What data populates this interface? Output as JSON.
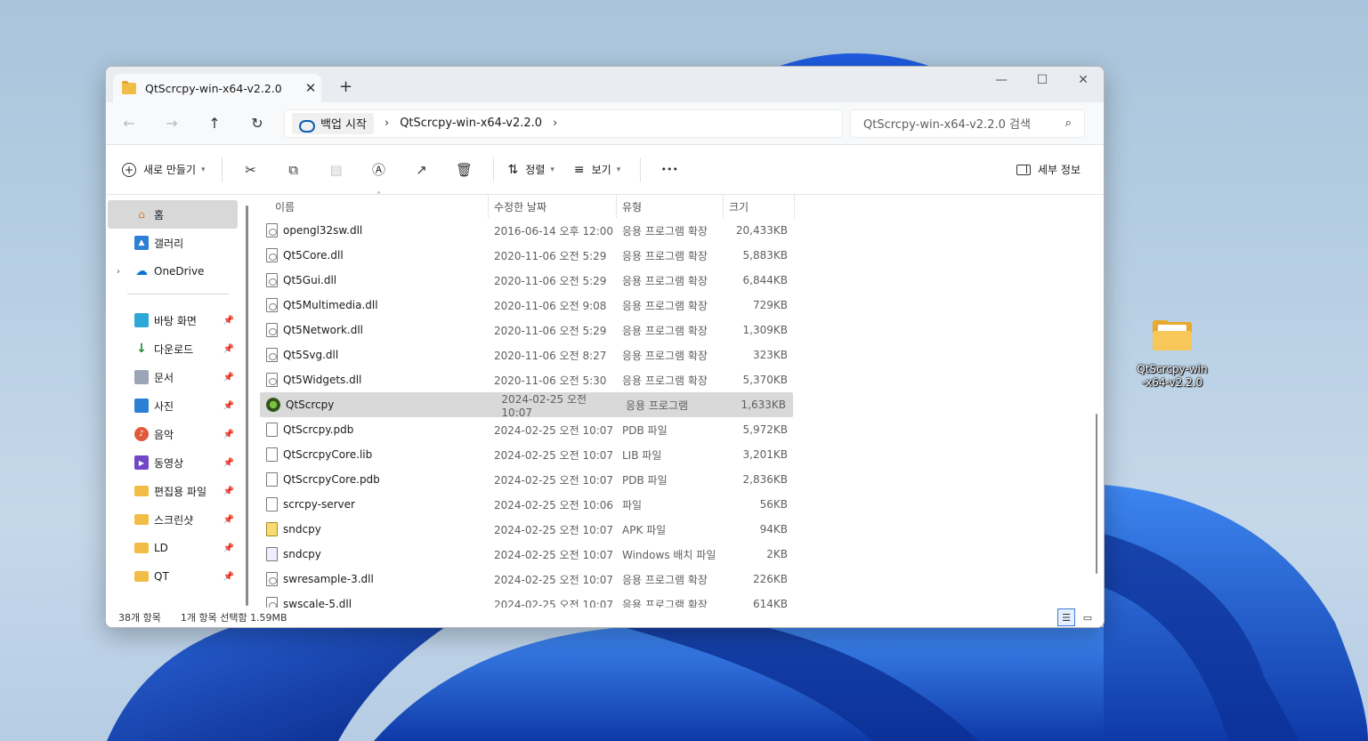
{
  "window": {
    "tab_title": "QtScrcpy-win-x64-v2.2.0",
    "tab_close": "✕",
    "new_tab": "+",
    "minimize": "—",
    "maximize": "☐",
    "close": "✕"
  },
  "navbar": {
    "back": "←",
    "forward": "→",
    "up": "↑",
    "refresh": "↻",
    "crumbs": [
      "백업 시작",
      "QtScrcpy-win-x64-v2.2.0"
    ],
    "search_placeholder": "QtScrcpy-win-x64-v2.2.0 검색"
  },
  "toolbar": {
    "new_label": "새로 만들기",
    "sort_label": "정렬",
    "view_label": "보기",
    "more": "•••",
    "details_label": "세부 정보",
    "icons": [
      "cut-icon",
      "copy-icon",
      "paste-icon",
      "rename-icon",
      "share-icon",
      "delete-icon"
    ]
  },
  "sidebar": {
    "top": [
      {
        "label": "홈",
        "icon": "home-icon"
      },
      {
        "label": "갤러리",
        "icon": "gallery-icon"
      },
      {
        "label": "OneDrive",
        "icon": "onedrive-icon"
      }
    ],
    "pinned": [
      {
        "label": "바탕 화면",
        "icon": "desktop-icon"
      },
      {
        "label": "다운로드",
        "icon": "download-icon"
      },
      {
        "label": "문서",
        "icon": "documents-icon"
      },
      {
        "label": "사진",
        "icon": "pictures-icon"
      },
      {
        "label": "음악",
        "icon": "music-icon"
      },
      {
        "label": "동영상",
        "icon": "videos-icon"
      },
      {
        "label": "편집용 파일",
        "icon": "folder-icon"
      },
      {
        "label": "스크린샷",
        "icon": "folder-icon"
      },
      {
        "label": "LD",
        "icon": "folder-icon"
      },
      {
        "label": "QT",
        "icon": "folder-icon"
      }
    ]
  },
  "columns": {
    "name": "이름",
    "date": "수정한 날짜",
    "type": "유형",
    "size": "크기"
  },
  "files": [
    {
      "name": "opengl32sw.dll",
      "date": "2016-06-14 오후 12:00",
      "type": "응용 프로그램 확장",
      "size": "20,433KB",
      "kind": "dll"
    },
    {
      "name": "Qt5Core.dll",
      "date": "2020-11-06 오전 5:29",
      "type": "응용 프로그램 확장",
      "size": "5,883KB",
      "kind": "dll"
    },
    {
      "name": "Qt5Gui.dll",
      "date": "2020-11-06 오전 5:29",
      "type": "응용 프로그램 확장",
      "size": "6,844KB",
      "kind": "dll"
    },
    {
      "name": "Qt5Multimedia.dll",
      "date": "2020-11-06 오전 9:08",
      "type": "응용 프로그램 확장",
      "size": "729KB",
      "kind": "dll"
    },
    {
      "name": "Qt5Network.dll",
      "date": "2020-11-06 오전 5:29",
      "type": "응용 프로그램 확장",
      "size": "1,309KB",
      "kind": "dll"
    },
    {
      "name": "Qt5Svg.dll",
      "date": "2020-11-06 오전 8:27",
      "type": "응용 프로그램 확장",
      "size": "323KB",
      "kind": "dll"
    },
    {
      "name": "Qt5Widgets.dll",
      "date": "2020-11-06 오전 5:30",
      "type": "응용 프로그램 확장",
      "size": "5,370KB",
      "kind": "dll"
    },
    {
      "name": "QtScrcpy",
      "date": "2024-02-25 오전 10:07",
      "type": "응용 프로그램",
      "size": "1,633KB",
      "kind": "app",
      "selected": true
    },
    {
      "name": "QtScrcpy.pdb",
      "date": "2024-02-25 오전 10:07",
      "type": "PDB 파일",
      "size": "5,972KB",
      "kind": "file"
    },
    {
      "name": "QtScrcpyCore.lib",
      "date": "2024-02-25 오전 10:07",
      "type": "LIB 파일",
      "size": "3,201KB",
      "kind": "file"
    },
    {
      "name": "QtScrcpyCore.pdb",
      "date": "2024-02-25 오전 10:07",
      "type": "PDB 파일",
      "size": "2,836KB",
      "kind": "file"
    },
    {
      "name": "scrcpy-server",
      "date": "2024-02-25 오전 10:06",
      "type": "파일",
      "size": "56KB",
      "kind": "file"
    },
    {
      "name": "sndcpy",
      "date": "2024-02-25 오전 10:07",
      "type": "APK 파일",
      "size": "94KB",
      "kind": "apk"
    },
    {
      "name": "sndcpy",
      "date": "2024-02-25 오전 10:07",
      "type": "Windows 배치 파일",
      "size": "2KB",
      "kind": "bat"
    },
    {
      "name": "swresample-3.dll",
      "date": "2024-02-25 오전 10:07",
      "type": "응용 프로그램 확장",
      "size": "226KB",
      "kind": "dll"
    },
    {
      "name": "swscale-5.dll",
      "date": "2024-02-25 오전 10:07",
      "type": "응용 프로그램 확장",
      "size": "614KB",
      "kind": "dll"
    }
  ],
  "status": {
    "count": "38개 항목",
    "selection": "1개 항목 선택함 1.59MB"
  },
  "desktop": {
    "icon_label": "QtScrcpy-win-x64-v2.2.0"
  }
}
